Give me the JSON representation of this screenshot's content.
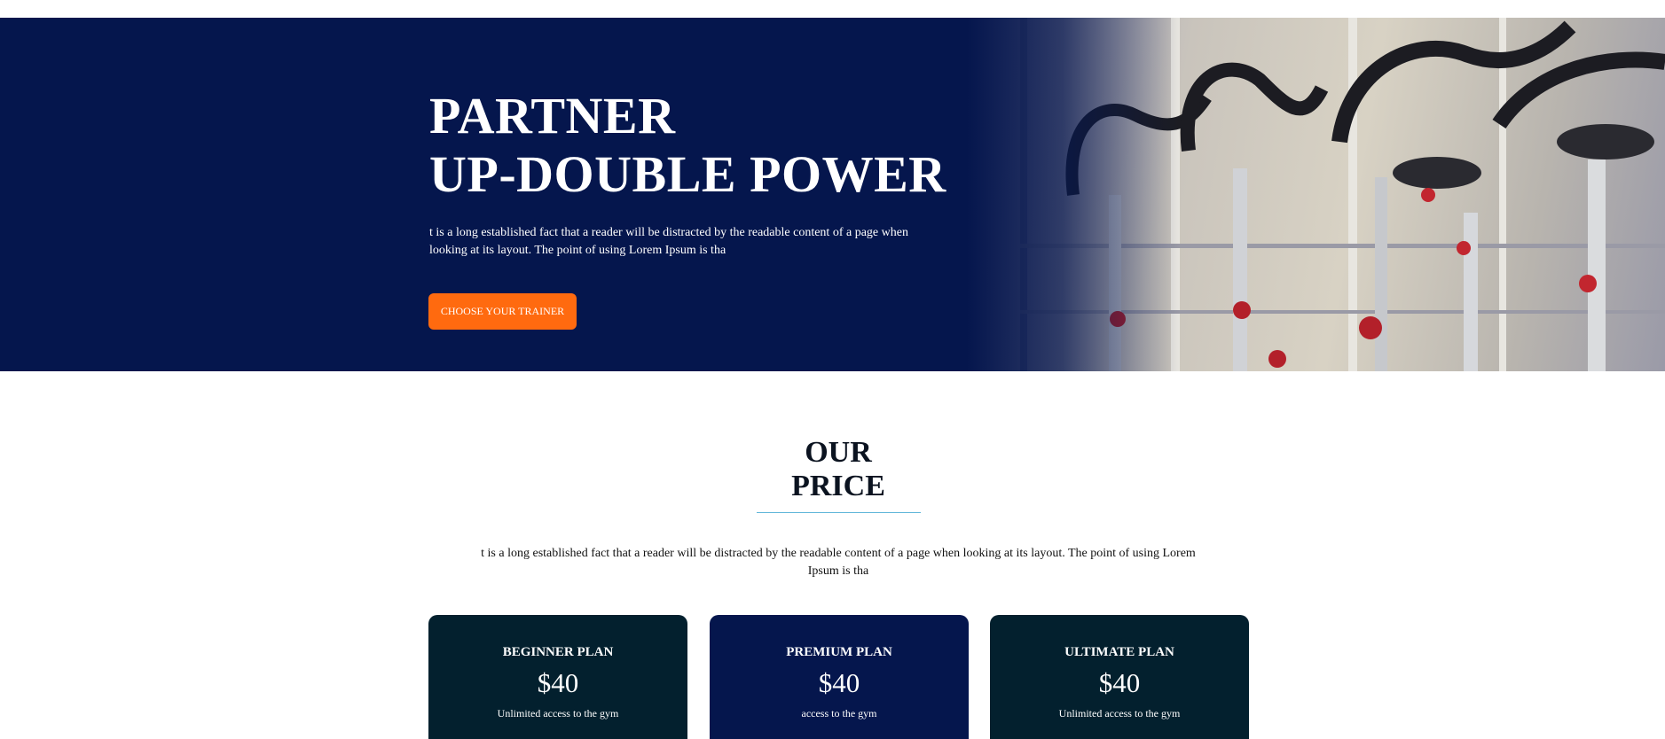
{
  "hero": {
    "title_line1": "PARTNER",
    "title_line2": "UP-DOUBLE POWER",
    "text": "t is a long established fact that a reader will be distracted by the readable content of a page when looking at its layout. The point of using Lorem Ipsum is tha",
    "button_label": "CHOOSE YOUR TRAINER"
  },
  "pricing": {
    "title_line1": "OUR",
    "title_line2": "PRICE",
    "text": "t is a long established fact that a reader will be distracted by the readable content of a page when looking at its layout. The point of using Lorem Ipsum is tha",
    "plans": [
      {
        "name": "BEGINNER PLAN",
        "price": "$40",
        "desc": "Unlimited access to the gym"
      },
      {
        "name": "PREMIUM PLAN",
        "price": "$40",
        "desc": "access to the gym"
      },
      {
        "name": "ULTIMATE PLAN",
        "price": "$40",
        "desc": "Unlimited access to the gym"
      }
    ]
  },
  "colors": {
    "hero_bg": "#05164d",
    "button": "#ff6a0f",
    "card_dark": "#03202e",
    "card_navy": "#05164d",
    "accent_rule": "#5fb6d9"
  }
}
